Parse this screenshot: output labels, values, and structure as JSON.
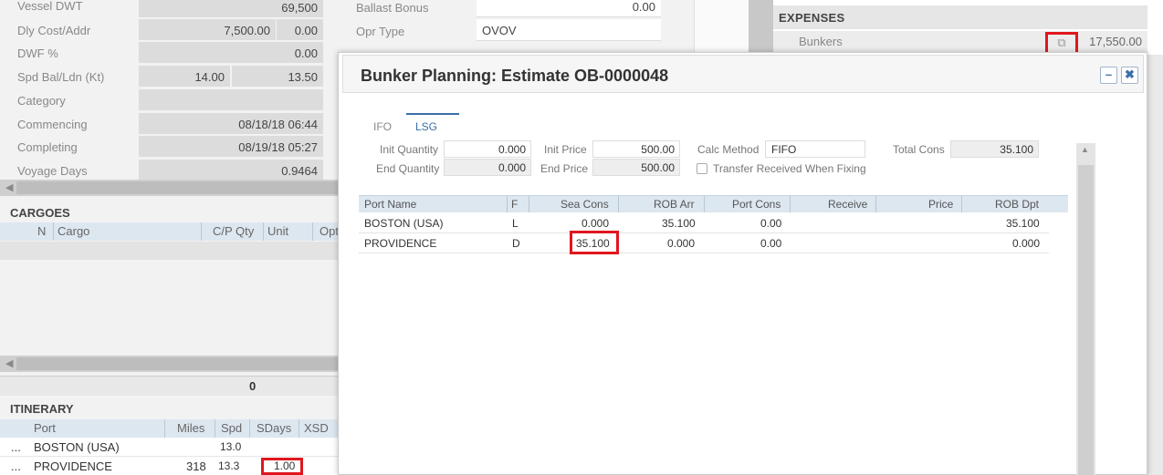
{
  "voyage": {
    "vessel_dwt": {
      "label": "Vessel DWT",
      "value": "69,500"
    },
    "dly_cost": {
      "label": "Dly Cost/Addr",
      "value1": "7,500.00",
      "value2": "0.00"
    },
    "dwf": {
      "label": "DWF %",
      "value": "0.00"
    },
    "spd": {
      "label": "Spd Bal/Ldn (Kt)",
      "value1": "14.00",
      "value2": "13.50"
    },
    "category": {
      "label": "Category",
      "value": ""
    },
    "commencing": {
      "label": "Commencing",
      "value": "08/18/18 06:44"
    },
    "completing": {
      "label": "Completing",
      "value": "08/19/18 05:27"
    },
    "voyage_days": {
      "label": "Voyage Days",
      "value": "0.9464"
    }
  },
  "mid": {
    "ballast_bonus": {
      "label": "Ballast Bonus",
      "value": "0.00"
    },
    "opr_type": {
      "label": "Opr Type",
      "value": "OVOV"
    }
  },
  "expenses": {
    "title": "EXPENSES",
    "bunkers_label": "Bunkers",
    "bunkers_value": "17,550.00"
  },
  "cargoes": {
    "title": "CARGOES",
    "columns": [
      "N",
      "Cargo",
      "C/P Qty",
      "Unit",
      "Opt"
    ],
    "total": "0"
  },
  "itinerary": {
    "title": "ITINERARY",
    "columns": [
      "Port",
      "Miles",
      "Spd",
      "SDays",
      "XSD"
    ],
    "rows": [
      {
        "dots": "...",
        "port": "BOSTON (USA)",
        "miles": "",
        "spd": "13.0",
        "sdays": ""
      },
      {
        "dots": "...",
        "port": "PROVIDENCE",
        "miles": "318",
        "spd": "13.3",
        "sdays": "1.00"
      }
    ]
  },
  "modal": {
    "title": "Bunker Planning: Estimate OB-0000048",
    "minimize": "–",
    "close": "✖",
    "tabs": [
      {
        "label": "IFO"
      },
      {
        "label": "LSG"
      }
    ],
    "fields": {
      "init_qty_label": "Init Quantity",
      "init_qty": "0.000",
      "end_qty_label": "End Quantity",
      "end_qty": "0.000",
      "init_price_label": "Init Price",
      "init_price": "500.00",
      "end_price_label": "End Price",
      "end_price": "500.00",
      "calc_method_label": "Calc Method",
      "calc_method": "FIFO",
      "transfer_label": "Transfer Received When Fixing",
      "total_cons_label": "Total Cons",
      "total_cons": "35.100"
    },
    "table": {
      "columns": [
        "Port Name",
        "F",
        "Sea Cons",
        "ROB Arr",
        "Port Cons",
        "Receive",
        "Price",
        "ROB Dpt"
      ],
      "rows": [
        {
          "port": "BOSTON (USA)",
          "f": "L",
          "sea_cons": "0.000",
          "rob_arr": "35.100",
          "port_cons": "0.00",
          "receive": "",
          "price": "",
          "rob_dpt": "35.100"
        },
        {
          "port": "PROVIDENCE",
          "f": "D",
          "sea_cons": "35.100",
          "rob_arr": "0.000",
          "port_cons": "0.00",
          "receive": "",
          "price": "",
          "rob_dpt": "0.000"
        }
      ]
    }
  },
  "colors": {
    "highlight": "#e0161e",
    "accent": "#3a6fa8"
  },
  "icons": {
    "bunkers_link": "external-link-icon"
  }
}
